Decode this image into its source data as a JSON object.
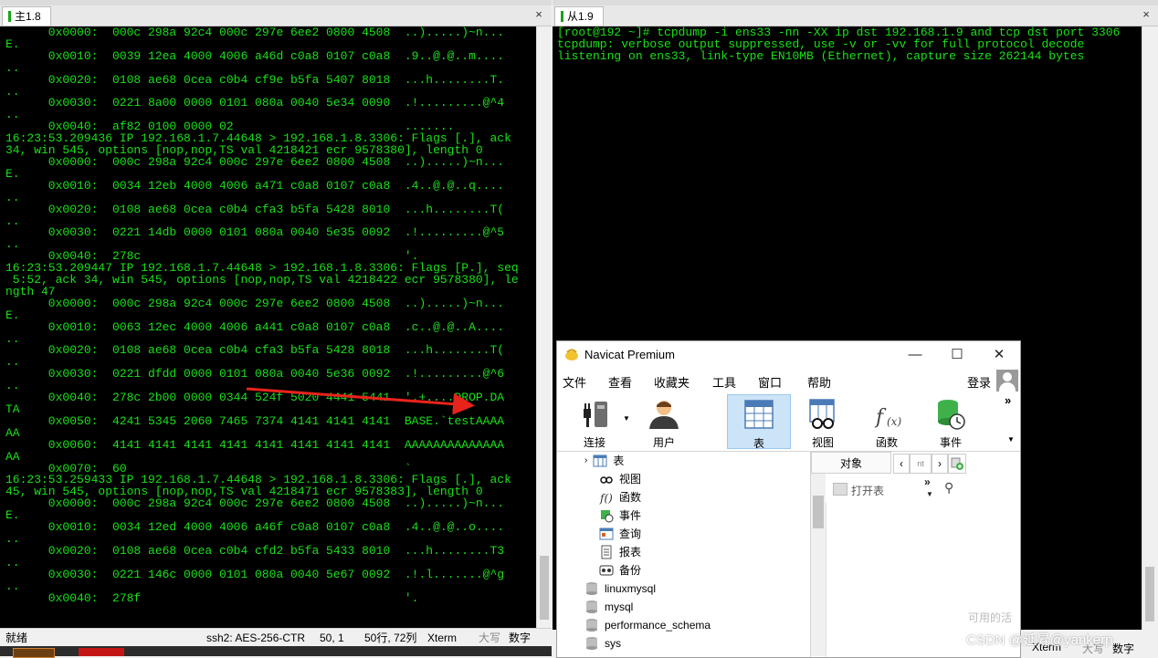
{
  "left_tab": {
    "label": "主1.8"
  },
  "right_tab": {
    "label": "从1.9"
  },
  "close_label": "×",
  "left_terminal_lines": [
    "      0x0000:  000c 298a 92c4 000c 297e 6ee2 0800 4508  ..).....)~n...",
    "E.",
    "      0x0010:  0039 12ea 4000 4006 a46d c0a8 0107 c0a8  .9..@.@..m....",
    "..",
    "      0x0020:  0108 ae68 0cea c0b4 cf9e b5fa 5407 8018  ...h........T.",
    "..",
    "      0x0030:  0221 8a00 0000 0101 080a 0040 5e34 0090  .!.........@^4",
    "..",
    "      0x0040:  af82 0100 0000 02                        .......",
    "16:23:53.209436 IP 192.168.1.7.44648 > 192.168.1.8.3306: Flags [.], ack",
    "34, win 545, options [nop,nop,TS val 4218421 ecr 9578380], length 0",
    "      0x0000:  000c 298a 92c4 000c 297e 6ee2 0800 4508  ..).....)~n...",
    "E.",
    "      0x0010:  0034 12eb 4000 4006 a471 c0a8 0107 c0a8  .4..@.@..q....",
    "..",
    "      0x0020:  0108 ae68 0cea c0b4 cfa3 b5fa 5428 8010  ...h........T(",
    "..",
    "      0x0030:  0221 14db 0000 0101 080a 0040 5e35 0092  .!.........@^5",
    "..",
    "      0x0040:  278c                                     '.",
    "16:23:53.209447 IP 192.168.1.7.44648 > 192.168.1.8.3306: Flags [P.], seq",
    " 5:52, ack 34, win 545, options [nop,nop,TS val 4218422 ecr 9578380], le",
    "ngth 47",
    "      0x0000:  000c 298a 92c4 000c 297e 6ee2 0800 4508  ..).....)~n...",
    "E.",
    "      0x0010:  0063 12ec 4000 4006 a441 c0a8 0107 c0a8  .c..@.@..A....",
    "..",
    "      0x0020:  0108 ae68 0cea c0b4 cfa3 b5fa 5428 8018  ...h........T(",
    "..",
    "      0x0030:  0221 dfdd 0000 0101 080a 0040 5e36 0092  .!.........@^6",
    "..",
    "      0x0040:  278c 2b00 0000 0344 524f 5020 4441 5441  '.+....DROP.DA",
    "TA",
    "      0x0050:  4241 5345 2060 7465 7374 4141 4141 4141  BASE.`testAAAA",
    "AA",
    "      0x0060:  4141 4141 4141 4141 4141 4141 4141 4141  AAAAAAAAAAAAAA",
    "AA",
    "      0x0070:  60                                       `",
    "16:23:53.259433 IP 192.168.1.7.44648 > 192.168.1.8.3306: Flags [.], ack",
    "45, win 545, options [nop,nop,TS val 4218471 ecr 9578383], length 0",
    "      0x0000:  000c 298a 92c4 000c 297e 6ee2 0800 4508  ..).....)~n...",
    "E.",
    "      0x0010:  0034 12ed 4000 4006 a46f c0a8 0107 c0a8  .4..@.@..o....",
    "..",
    "      0x0020:  0108 ae68 0cea c0b4 cfd2 b5fa 5433 8010  ...h........T3",
    "..",
    "      0x0030:  0221 146c 0000 0101 080a 0040 5e67 0092  .!.l.......@^g",
    "..",
    "      0x0040:  278f                                     '."
  ],
  "right_terminal": {
    "prompt": "[root@192 ~]# ",
    "command": "tcpdump -i ens33 -nn -XX ip dst 192.168.1.9 and tcp dst port 3306",
    "lines": [
      "tcpdump: verbose output suppressed, use -v or -vv for full protocol decode",
      "listening on ens33, link-type EN10MB (Ethernet), capture size 262144 bytes"
    ]
  },
  "statusbar": {
    "ready": "就绪",
    "ssh": "ssh2: AES-256-CTR",
    "cursor": "50,  1",
    "size": "50行, 72列",
    "term": "Xterm",
    "caps": "大写",
    "num": "数字"
  },
  "right_status_fragments": {
    "term": "Xterm",
    "caps": "大写",
    "num": "数字"
  },
  "navicat": {
    "title": "Navicat Premium",
    "window": {
      "minimize": "—",
      "maximize": "☐",
      "close": "✕"
    },
    "menu": [
      "文件",
      "查看",
      "收藏夹",
      "工具",
      "窗口",
      "帮助"
    ],
    "login": "登录",
    "toolbar": [
      {
        "label": "连接",
        "icon": "plug-icon"
      },
      {
        "label": "用户",
        "icon": "user-icon"
      },
      {
        "label": "表",
        "icon": "table-icon"
      },
      {
        "label": "视图",
        "icon": "view-icon"
      },
      {
        "label": "函数",
        "icon": "function-icon"
      },
      {
        "label": "事件",
        "icon": "event-icon"
      }
    ],
    "more": "»",
    "tree_children": [
      "表",
      "视图",
      "函数",
      "事件",
      "查询",
      "报表",
      "备份"
    ],
    "tree_databases": [
      "linuxmysql",
      "mysql",
      "performance_schema",
      "sys"
    ],
    "objects_tab": "对象",
    "open_table": "打开表",
    "fragment_text": "可用的活",
    "placeholder_ellipsis": "nt"
  },
  "watermark": "CSDN @延昇@yankerp",
  "colors": {
    "terminal_green": "#19e019",
    "terminal_bg": "#000000",
    "arrow_red": "#e8231c",
    "active_tool": "#cce4f7"
  }
}
